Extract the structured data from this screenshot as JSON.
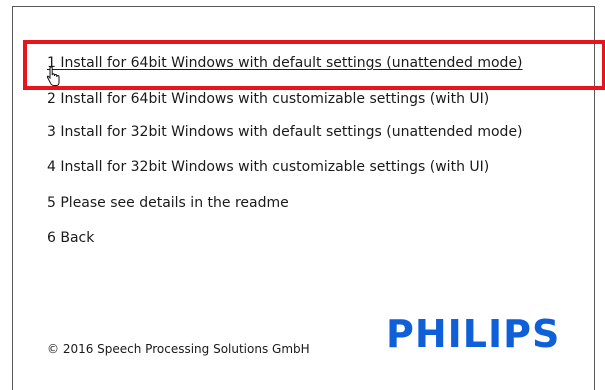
{
  "menu": {
    "items": [
      {
        "label": "1 Install for 64bit Windows with default settings (unattended mode)"
      },
      {
        "label": "2 Install for 64bit Windows with customizable settings (with UI)"
      },
      {
        "label": "3 Install for 32bit Windows with default settings (unattended mode)"
      },
      {
        "label": "4 Install for 32bit Windows with customizable settings (with UI)"
      },
      {
        "label": "5 Please see details in the readme"
      },
      {
        "label": "6 Back"
      }
    ]
  },
  "footer": {
    "copyright": "© 2016 Speech Processing Solutions GmbH",
    "brand": "PHILIPS"
  },
  "colors": {
    "highlight": "#e8141b",
    "brand": "#0e5fd8",
    "text": "#1a1a1a"
  },
  "icons": {
    "cursor": "hand-pointer-icon"
  }
}
